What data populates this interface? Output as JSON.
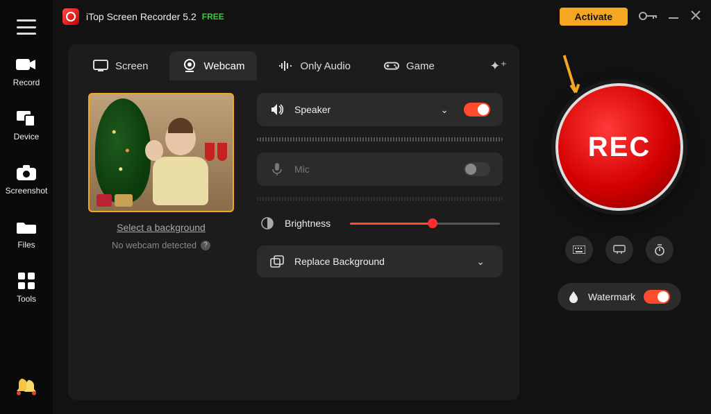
{
  "app": {
    "title": "iTop Screen Recorder 5.2",
    "badge": "FREE",
    "activate": "Activate"
  },
  "sidebar": {
    "items": [
      {
        "label": "Record"
      },
      {
        "label": "Device"
      },
      {
        "label": "Screenshot"
      },
      {
        "label": "Files"
      },
      {
        "label": "Tools"
      }
    ]
  },
  "tabs": {
    "screen": "Screen",
    "webcam": "Webcam",
    "audio": "Only Audio",
    "game": "Game"
  },
  "preview": {
    "select_bg": "Select a background",
    "no_webcam": "No webcam detected"
  },
  "controls": {
    "speaker": "Speaker",
    "mic": "Mic",
    "brightness": "Brightness",
    "replace_bg": "Replace Background"
  },
  "rec": {
    "label": "REC"
  },
  "watermark": {
    "label": "Watermark"
  }
}
